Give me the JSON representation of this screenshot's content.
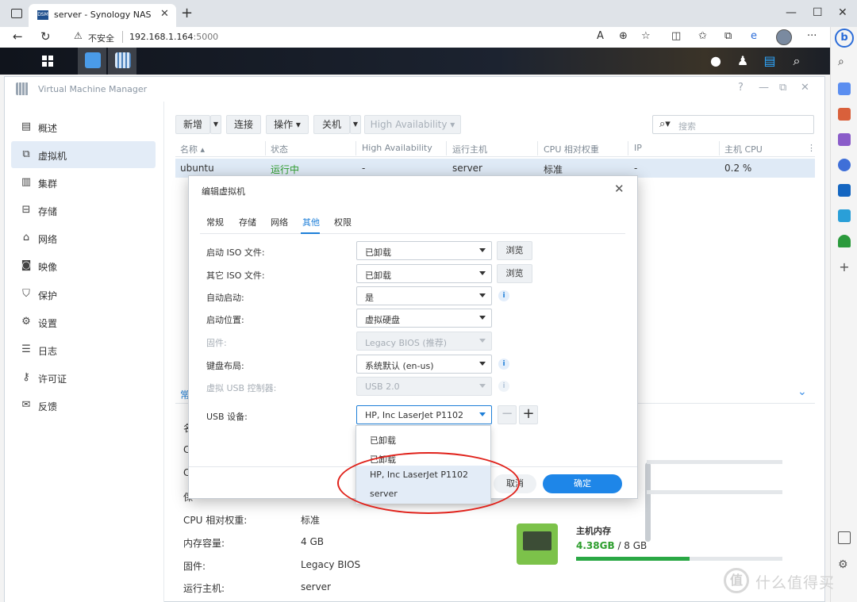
{
  "browser": {
    "tab_title": "server - Synology NAS",
    "tab_favicon": "DSM",
    "security_label": "不安全",
    "url_host": "192.168.1.164",
    "url_port": ":5000"
  },
  "app": {
    "title": "Virtual Machine Manager"
  },
  "sidebar": {
    "items": [
      {
        "label": "概述",
        "icon": "overview-icon"
      },
      {
        "label": "虚拟机",
        "icon": "vm-icon"
      },
      {
        "label": "集群",
        "icon": "cluster-icon"
      },
      {
        "label": "存储",
        "icon": "storage-icon"
      },
      {
        "label": "网络",
        "icon": "network-icon"
      },
      {
        "label": "映像",
        "icon": "image-icon"
      },
      {
        "label": "保护",
        "icon": "shield-icon"
      },
      {
        "label": "设置",
        "icon": "gear-icon"
      },
      {
        "label": "日志",
        "icon": "log-icon"
      },
      {
        "label": "许可证",
        "icon": "key-icon"
      },
      {
        "label": "反馈",
        "icon": "mail-icon"
      }
    ],
    "active_index": 1
  },
  "toolbar": {
    "create": "新增",
    "connect": "连接",
    "action": "操作 ▾",
    "shutdown": "关机",
    "high_availability": "High Availability ▾",
    "search_placeholder": "搜索"
  },
  "grid": {
    "headers": [
      "名称 ▴",
      "状态",
      "High Availability",
      "运行主机",
      "CPU 相对权重",
      "IP",
      "主机 CPU"
    ],
    "rows": [
      {
        "name": "ubuntu",
        "status": "运行中",
        "ha": "-",
        "host": "server",
        "cpu_weight": "标准",
        "ip": "-",
        "host_cpu": "0.2 %"
      }
    ]
  },
  "detail": {
    "tab_partial": "常",
    "rows": [
      {
        "label": "CPU 相对权重:",
        "value": "标准"
      },
      {
        "label": "内存容量:",
        "value": "4 GB"
      },
      {
        "label": "固件:",
        "value": "Legacy BIOS"
      },
      {
        "label": "运行主机:",
        "value": "server"
      }
    ],
    "partial_labels": [
      "名",
      "C",
      "C",
      "保"
    ],
    "memory": {
      "title": "主机内存",
      "used": "4.38",
      "used_unit": "GB",
      "total": "/ 8 GB",
      "fraction": 0.55
    }
  },
  "modal": {
    "title": "编辑虚拟机",
    "tabs": [
      "常规",
      "存储",
      "网络",
      "其他",
      "权限"
    ],
    "active_tab": 3,
    "fields": [
      {
        "label": "启动 ISO 文件:",
        "value": "已卸载",
        "browse": "浏览"
      },
      {
        "label": "其它 ISO 文件:",
        "value": "已卸载",
        "browse": "浏览"
      },
      {
        "label": "自动启动:",
        "value": "是"
      },
      {
        "label": "启动位置:",
        "value": "虚拟硬盘"
      },
      {
        "label": "固件:",
        "value": "Legacy BIOS (推荐)"
      },
      {
        "label": "键盘布局:",
        "value": "系统默认 (en-us)"
      },
      {
        "label": "虚拟 USB 控制器:",
        "value": "USB 2.0"
      },
      {
        "label": "USB 设备:",
        "value": "HP, Inc LaserJet P1102"
      }
    ],
    "cancel": "取消",
    "ok": "确定"
  },
  "usb_dropdown": {
    "options": [
      "已卸载",
      "已卸载",
      "HP, Inc LaserJet P1102",
      "server"
    ]
  },
  "watermark": {
    "logo": "值",
    "text": "什么值得买"
  },
  "colors": {
    "accent": "#1e86e8",
    "running": "#2e9e2e",
    "annotation": "#e0221b"
  }
}
